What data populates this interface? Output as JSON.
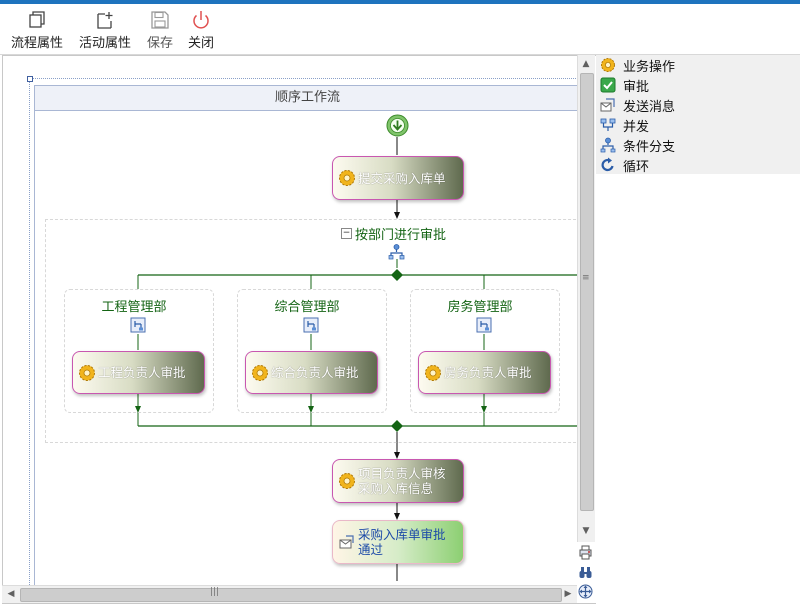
{
  "toolbar": {
    "process_props": "流程属性",
    "activity_props": "活动属性",
    "save": "保存",
    "close": "关闭"
  },
  "workflow": {
    "sequence_title": "顺序工作流",
    "submit_activity": "提交采购入库单",
    "parallel_title": "按部门进行审批",
    "branches": [
      {
        "department": "工程管理部",
        "activity": "工程负责人审批"
      },
      {
        "department": "综合管理部",
        "activity": "综合负责人审批"
      },
      {
        "department": "房务管理部",
        "activity": "房务负责人审批"
      }
    ],
    "review_activity": "项目负责人审核采购入库信息",
    "approved_activity": "采购入库单审批通过"
  },
  "toolbox": {
    "items": [
      "业务操作",
      "审批",
      "发送消息",
      "并发",
      "条件分支",
      "循环"
    ]
  },
  "colors": {
    "accent": "#1e73be",
    "connector": "#146414",
    "activity_border": "#c857b0",
    "close_icon": "#e05050"
  }
}
